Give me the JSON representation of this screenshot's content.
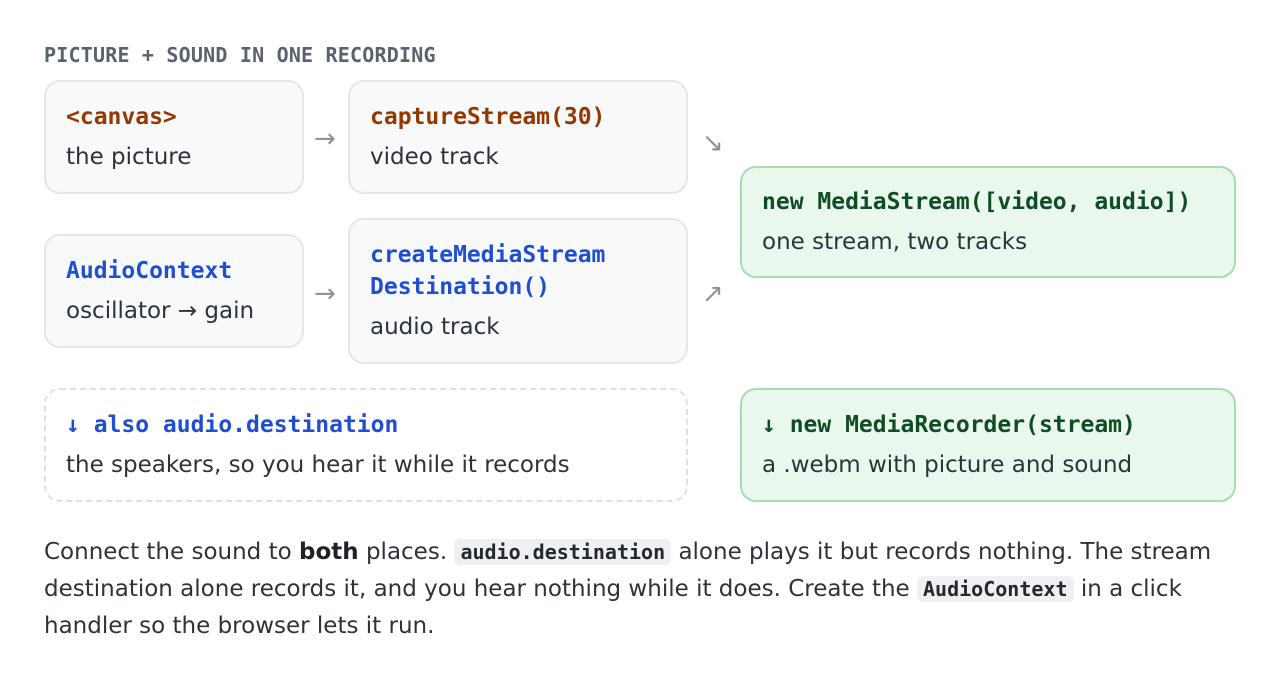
{
  "heading": "PICTURE + SOUND IN ONE RECORDING",
  "boxes": {
    "canvas": {
      "code": "<canvas>",
      "desc": "the picture"
    },
    "capture": {
      "code": "captureStream(30)",
      "desc": "video track"
    },
    "audioctx": {
      "code": "AudioContext",
      "desc": "oscillator → gain"
    },
    "createdest": {
      "code_line1": "createMediaStream",
      "code_line2": "Destination()",
      "desc": "audio track"
    },
    "mediastream": {
      "code": "new MediaStream([video, audio])",
      "desc": "one stream, two tracks"
    },
    "also": {
      "code": "↓ also audio.destination",
      "desc": "the speakers, so you hear it while it records"
    },
    "recorder": {
      "code": "↓ new MediaRecorder(stream)",
      "desc": "a .webm with picture and sound"
    }
  },
  "arrows": {
    "right": "→",
    "down_right": "↘",
    "up_right": "↗"
  },
  "paragraph": {
    "p1": "Connect the sound to ",
    "bold": "both",
    "p2": " places. ",
    "code1": "audio.destination",
    "p3": " alone plays it but records nothing. The stream destination alone records it, and you hear nothing while it does. Create the ",
    "code2": "AudioContext",
    "p4": " in a click handler so the browser lets it run."
  },
  "colors": {
    "code_brown": "#953800",
    "code_blue": "#1f4fd0",
    "code_green": "#0f4d25",
    "box_green_bg": "#eaf7ec",
    "box_gray_bg": "#f8f9fb"
  }
}
